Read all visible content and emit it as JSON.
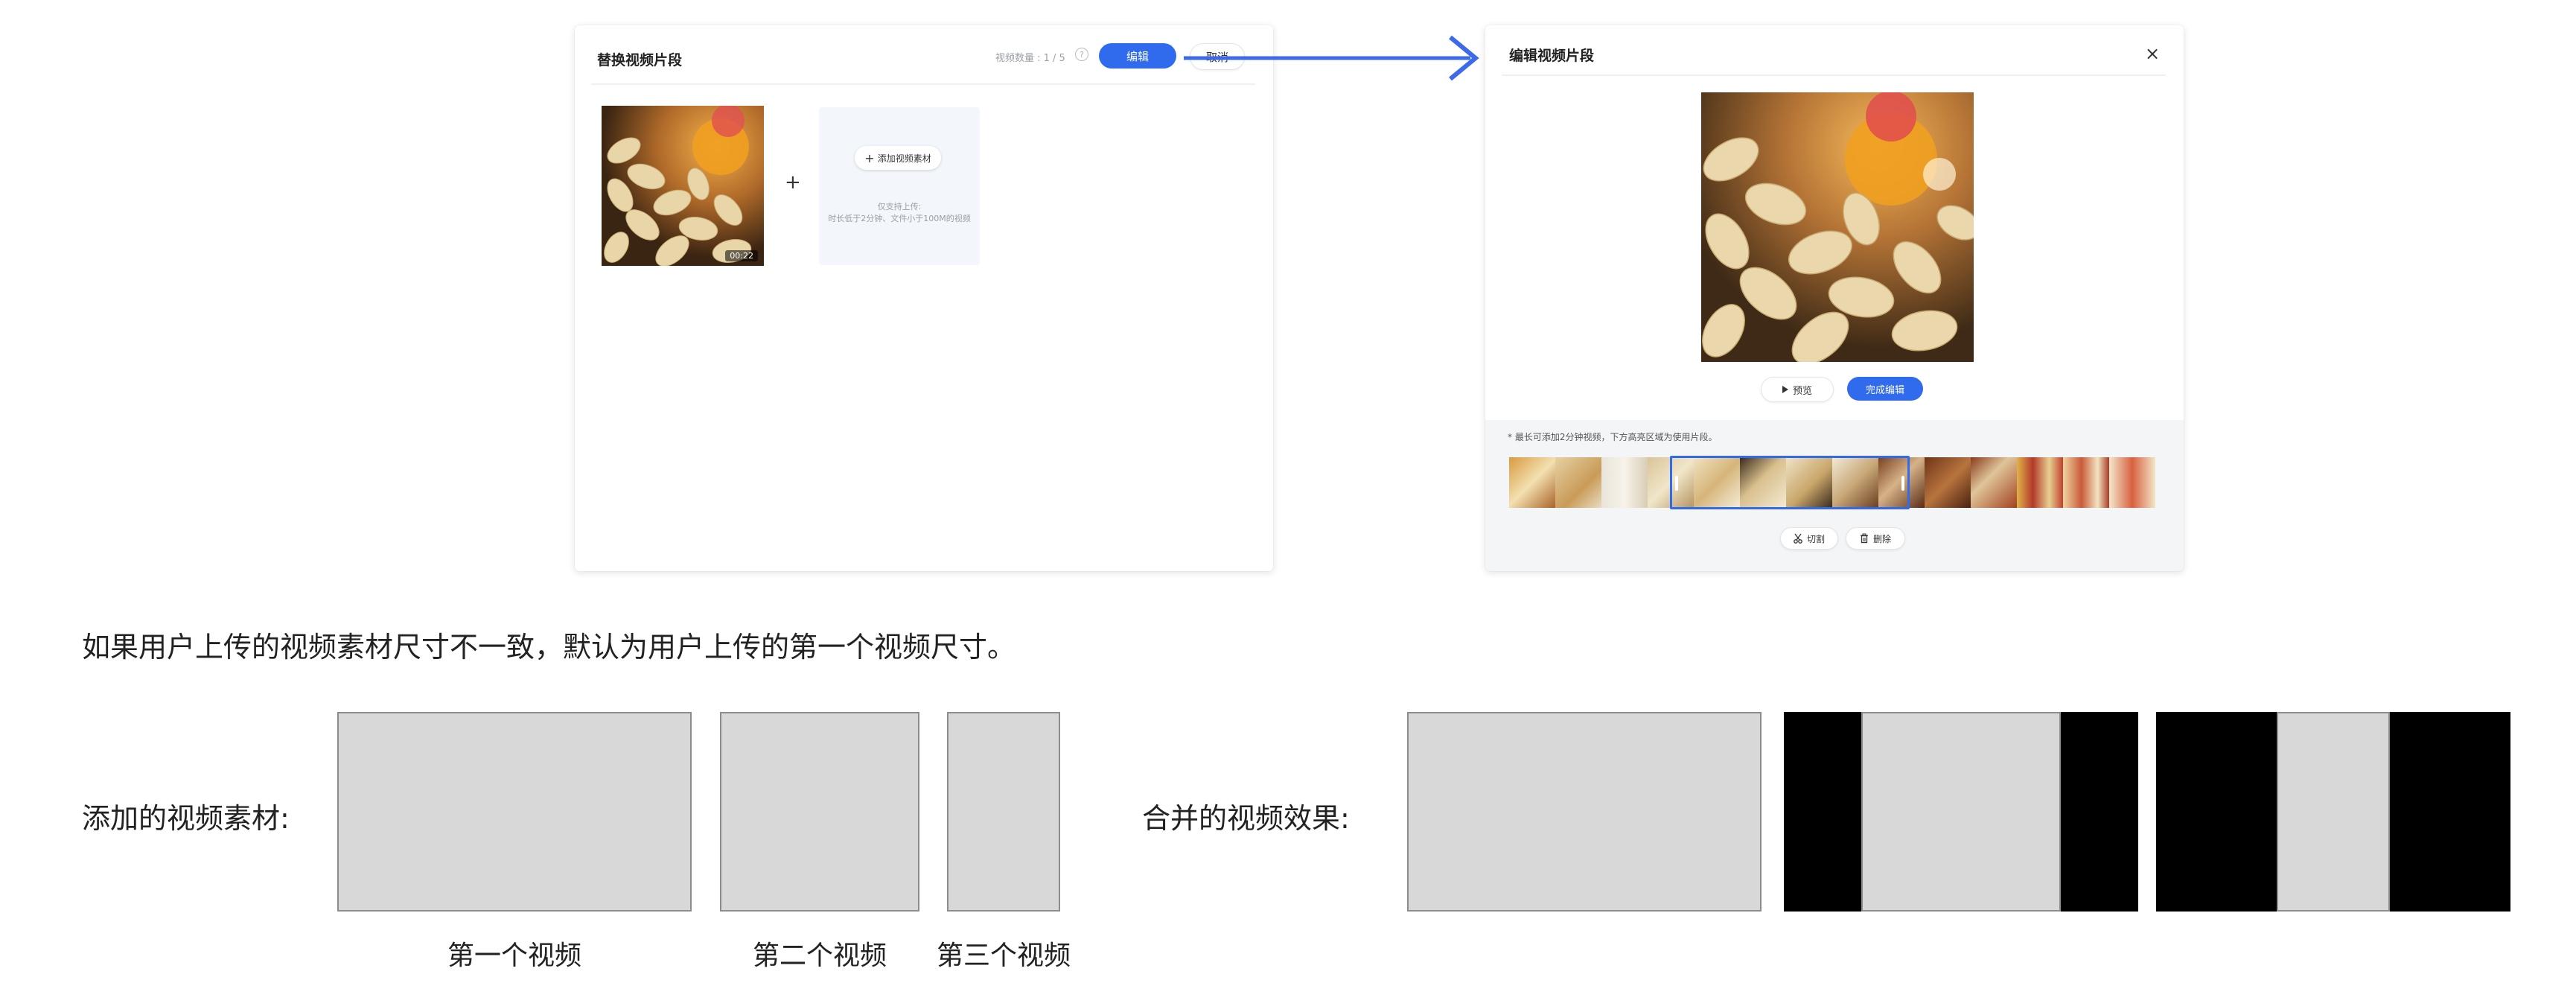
{
  "left_dialog": {
    "title": "替换视频片段",
    "count_label": "视频数量 : 1 / 5",
    "help_icon": "?",
    "edit_label": "编辑",
    "cancel_label": "取消",
    "clip_duration": "00:22",
    "plus": "+",
    "add_icon": "+",
    "add_label": "添加视频素材",
    "add_hint_1": "仅支持上传:",
    "add_hint_2": "时长低于2分钟、文件小于100M的视频"
  },
  "right_dialog": {
    "title": "编辑视频片段",
    "close_icon": "×",
    "preview_label": "预览",
    "done_label": "完成编辑",
    "timeline_note": "* 最长可添加2分钟视频，下方高亮区域为使用片段。",
    "cut_label": "切割",
    "delete_label": "删除"
  },
  "explanation": {
    "note": "如果用户上传的视频素材尺寸不一致，默认为用户上传的第一个视频尺寸。",
    "added_label": "添加的视频素材:",
    "merged_label": "合并的视频效果:",
    "caption_1": "第一个视频",
    "caption_2": "第二个视频",
    "caption_3": "第三个视频"
  },
  "colors": {
    "primary": "#2f6bec",
    "arrow": "#3d6ae8",
    "placeholder_gray": "#d8d8d8",
    "letterbox": "#000000"
  },
  "icons": [
    "help-icon",
    "plus-icon",
    "close-icon",
    "play-icon",
    "scissors-icon",
    "trash-icon",
    "arrow-icon"
  ]
}
